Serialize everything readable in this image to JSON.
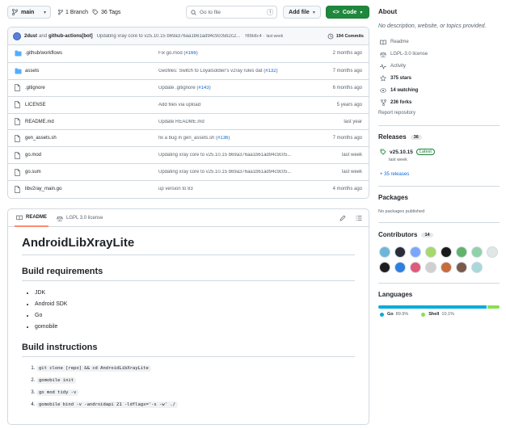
{
  "toolbar": {
    "branch": "main",
    "branch_count": "1 Branch",
    "tag_count": "36 Tags",
    "search_placeholder": "Go to file",
    "search_shortcut": "t",
    "add_file": "Add file",
    "code": "Code"
  },
  "commit": {
    "author1": "2dust",
    "and": "and",
    "author2": "github-actions[bot]",
    "message": "Updating xray core to v25.10.15 b69a376aa1b61ad94c9c05b2c2...",
    "sha": "f89b8c4",
    "sep": "·",
    "time": "last week",
    "count": "194 Commits"
  },
  "files": [
    {
      "name": ".github/workflows",
      "type": "dir",
      "msg": "Fix go.mod (",
      "link": "#166",
      "msg_end": ")",
      "time": "2 months ago"
    },
    {
      "name": "assets",
      "type": "dir",
      "msg": "Geofiles: Switch to Loyalsoldier's v2ray rules dat (",
      "link": "#132",
      "msg_end": ")",
      "time": "7 months ago"
    },
    {
      "name": ".gitignore",
      "type": "file",
      "msg": "Update .gitignore (",
      "link": "#143",
      "msg_end": ")",
      "time": "6 months ago"
    },
    {
      "name": "LICENSE",
      "type": "file",
      "msg": "Add files via upload",
      "link": "",
      "msg_end": "",
      "time": "5 years ago"
    },
    {
      "name": "README.md",
      "type": "file",
      "msg": "Update README.md",
      "link": "",
      "msg_end": "",
      "time": "last year"
    },
    {
      "name": "gen_assets.sh",
      "type": "file",
      "msg": "fix a bug in gen_assets.sh (",
      "link": "#136",
      "msg_end": ")",
      "time": "7 months ago"
    },
    {
      "name": "go.mod",
      "type": "file",
      "msg": "Updating xray core to v25.10.15 b69a376aa1b61ad94c9c05...",
      "link": "",
      "msg_end": "",
      "time": "last week"
    },
    {
      "name": "go.sum",
      "type": "file",
      "msg": "Updating xray core to v25.10.15 b69a376aa1b61ad94c9c05...",
      "link": "",
      "msg_end": "",
      "time": "last week"
    },
    {
      "name": "libv2ray_main.go",
      "type": "file",
      "msg": "up version to 83",
      "link": "",
      "msg_end": "",
      "time": "4 months ago"
    }
  ],
  "readme": {
    "tab_readme": "README",
    "tab_license": "LGPL 3.0 license",
    "title": "AndroidLibXrayLite",
    "req_heading": "Build requirements",
    "requirements": [
      "JDK",
      "Android SDK",
      "Go",
      "gomobile"
    ],
    "inst_heading": "Build instructions",
    "instructions": [
      "git clone [repo] && cd AndroidLibXrayLite",
      "gomobile init",
      "go mod tidy -v",
      "gomobile bind -v -androidapi 21 -ldflags='-s -w' ./"
    ]
  },
  "about": {
    "title": "About",
    "description": "No description, website, or topics provided.",
    "items": {
      "readme": "Readme",
      "license": "LGPL-3.0 license",
      "activity": "Activity",
      "stars": "375 stars",
      "watching": "14 watching",
      "forks": "236 forks",
      "report": "Report repository"
    }
  },
  "releases": {
    "title": "Releases",
    "count": "36",
    "version": "v25.10.15",
    "latest": "Latest",
    "date": "last week",
    "more": "+ 35 releases"
  },
  "packages": {
    "title": "Packages",
    "text": "No packages published"
  },
  "contributors": {
    "title": "Contributors",
    "count": "14",
    "avatar_colors": [
      "#6cb6d8",
      "#2b2d3a",
      "#7aa6ff",
      "#a6d96a",
      "#1a1a1a",
      "#5fb36b",
      "#8fd3a8",
      "#dfe8e6",
      "#1e1e1e",
      "#2d7fe0",
      "#e05a7a",
      "#d0d0d0",
      "#c96a3a",
      "#7a5a4a",
      "#a8d8dc"
    ]
  },
  "languages": {
    "title": "Languages",
    "items": [
      {
        "name": "Go",
        "pct": "89.9%",
        "value": 89.9,
        "color": "#00add8"
      },
      {
        "name": "Shell",
        "pct": "10.1%",
        "value": 10.1,
        "color": "#89e051"
      }
    ]
  }
}
